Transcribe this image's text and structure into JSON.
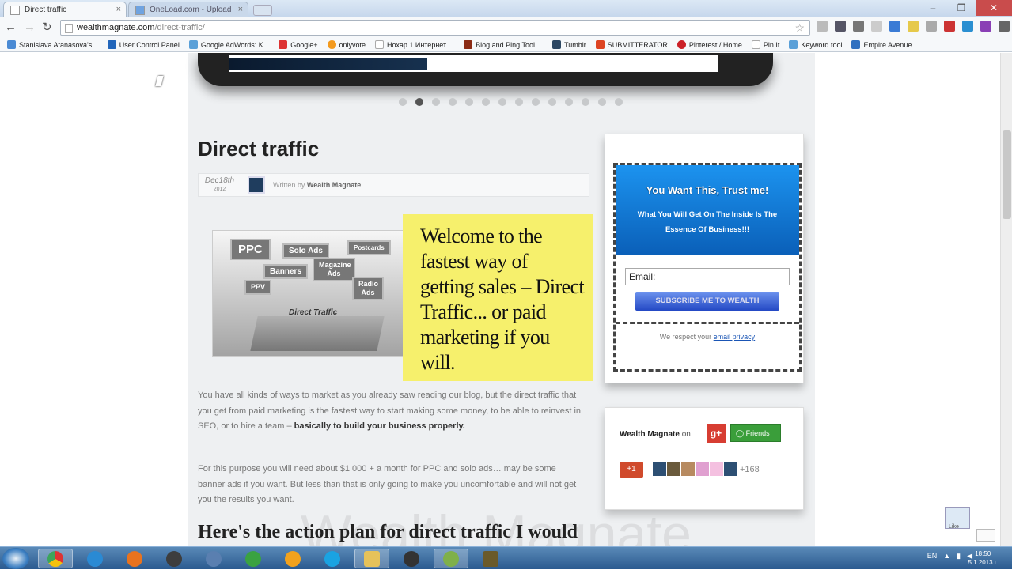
{
  "browser": {
    "tabs": [
      {
        "title": "Direct traffic",
        "active": true
      },
      {
        "title": "OneLoad.com - Upload",
        "active": false
      }
    ],
    "url_domain": "wealthmagnate.com",
    "url_path": "/direct-traffic/",
    "bookmarks": [
      "Stanislava Atanasova's...",
      "User Control Panel",
      "Google AdWords: K...",
      "Google+",
      "onlyvote",
      "Нохар 1 Интернет ...",
      "Blog and Ping Tool ...",
      "Tumblr",
      "SUBMITTERATOR",
      "Pinterest / Home",
      "Pin It",
      "Keyword tool",
      "Empire Avenue"
    ]
  },
  "post": {
    "title": "Direct traffic",
    "date_month_day": "Dec18th",
    "date_year": "2012",
    "written_by": "Written by",
    "author": "Wealth Magnate",
    "hero_tags": [
      "PPC",
      "Solo Ads",
      "Postcards",
      "Banners",
      "Magazine Ads",
      "PPV",
      "Radio Ads",
      "Direct Traffic"
    ],
    "welcome_text": "Welcome to the fastest way of getting sales – Direct Traffic... or paid marketing if you will.",
    "para1_text": "You have all kinds of ways to market as you already saw reading our blog, but the direct traffic that you get from paid marketing is the fastest way to start making some money, to be able to reinvest in SEO, or to hire a team – ",
    "para1_bold": "basically to build your business properly.",
    "para2_text": "For this purpose you will need about $1 000 + a month for PPC and solo ads… may be some banner ads if you want. But less than that is only going to make you uncomfortable and will not get you the results you want.",
    "heading2": "Here's the action plan for direct traffic I would",
    "watermark": "Wealth Magnate"
  },
  "optin": {
    "headline": "You Want This, Trust me!",
    "subhead": "What You Will Get On The Inside Is The Essence Of Business!!!",
    "email_placeholder": "Email:",
    "button": "SUBSCRIBE ME TO WEALTH",
    "privacy_prefix": "We respect your ",
    "privacy_link": "email privacy"
  },
  "gplus": {
    "name": "Wealth Magnate",
    "on": "on",
    "badge": "g+",
    "friends": "Friends",
    "plus_one": "+1",
    "count": "+168"
  },
  "taskbar": {
    "lang": "EN",
    "time": "18:50",
    "date": "5.1.2013 г."
  },
  "colors": {
    "accent_blue": "#0a5fb8",
    "highlight_yellow": "#f6f06c",
    "gplus_red": "#d73d32",
    "friends_green": "#3a9e3a"
  }
}
